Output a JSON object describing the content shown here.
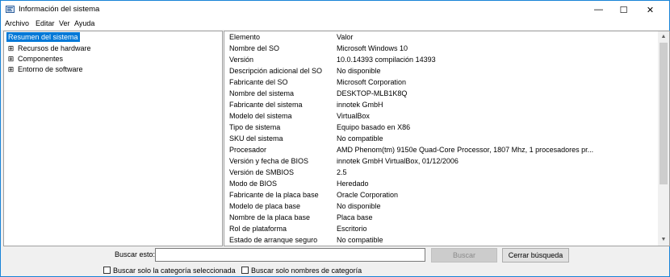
{
  "window": {
    "title": "Información del sistema",
    "app_icon": "system-info-icon",
    "controls": {
      "minimize": "—",
      "maximize": "☐",
      "close": "✕"
    }
  },
  "menu": [
    "Archivo",
    "Editar",
    "Ver",
    "Ayuda"
  ],
  "tree": {
    "selected": "Resumen del sistema",
    "items": [
      {
        "expander": "⊞",
        "label": "Recursos de hardware"
      },
      {
        "expander": "⊞",
        "label": "Componentes"
      },
      {
        "expander": "⊞",
        "label": "Entorno de software"
      }
    ]
  },
  "table": {
    "headers": [
      "Elemento",
      "Valor"
    ],
    "rows": [
      [
        "Nombre del SO",
        "Microsoft Windows 10"
      ],
      [
        "Versión",
        "10.0.14393 compilación 14393"
      ],
      [
        "Descripción adicional del SO",
        "No disponible"
      ],
      [
        "Fabricante del SO",
        "Microsoft Corporation"
      ],
      [
        "Nombre del sistema",
        "DESKTOP-MLB1K8Q"
      ],
      [
        "Fabricante del sistema",
        "innotek GmbH"
      ],
      [
        "Modelo del sistema",
        "VirtualBox"
      ],
      [
        "Tipo de sistema",
        "Equipo basado en X86"
      ],
      [
        "SKU del sistema",
        "No compatible"
      ],
      [
        "Procesador",
        "AMD Phenom(tm) 9150e Quad-Core Processor, 1807 Mhz, 1 procesadores pr..."
      ],
      [
        "Versión y fecha de BIOS",
        "innotek GmbH VirtualBox, 01/12/2006"
      ],
      [
        "Versión de SMBIOS",
        "2.5"
      ],
      [
        "Modo de BIOS",
        "Heredado"
      ],
      [
        "Fabricante de la placa base",
        "Oracle Corporation"
      ],
      [
        "Modelo de placa base",
        "No disponible"
      ],
      [
        "Nombre de la placa base",
        "Placa base"
      ],
      [
        "Rol de plataforma",
        "Escritorio"
      ],
      [
        "Estado de arranque seguro",
        "No compatible"
      ]
    ]
  },
  "scrollbar": {
    "up": "▲",
    "down": "▼"
  },
  "search": {
    "label": "Buscar esto:",
    "value": "",
    "search_button": "Buscar",
    "close_button": "Cerrar búsqueda",
    "option_selected_category": "Buscar solo la categoría seleccionada",
    "option_category_names": "Buscar solo nombres de categoría"
  }
}
